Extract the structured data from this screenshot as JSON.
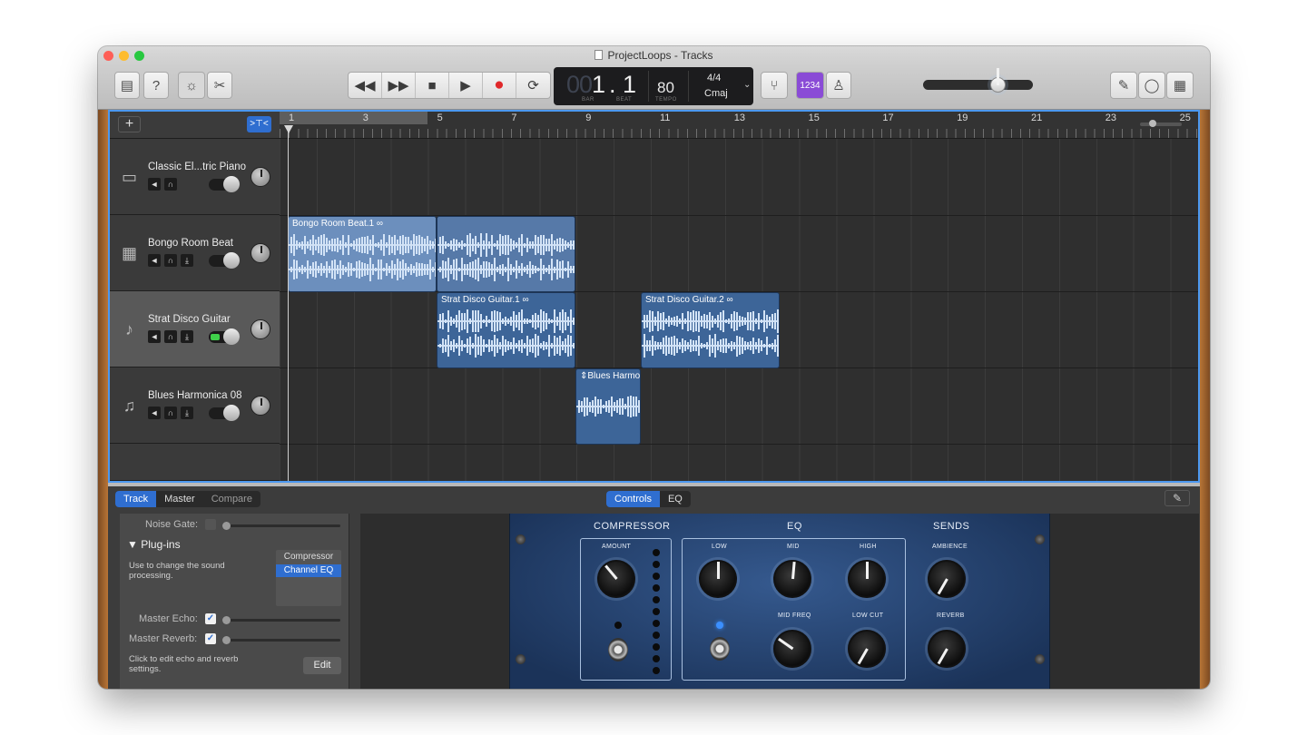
{
  "window": {
    "title": "ProjectLoops - Tracks"
  },
  "traffic_colors": {
    "close": "#fe5f57",
    "minimize": "#febc2e",
    "zoom": "#28c840"
  },
  "toolbar": {
    "lcd": {
      "bar_dim": "00",
      "bar": "1",
      "beat": ". 1",
      "bar_label": "BAR",
      "beat_label": "BEAT",
      "tempo": "80",
      "tempo_label": "TEMPO",
      "time_signature": "4/4",
      "key": "Cmaj"
    },
    "count_in": "1234",
    "master_volume": 0.69
  },
  "ruler": {
    "marks": [
      "1",
      "3",
      "5",
      "7",
      "9",
      "11",
      "13",
      "15",
      "17",
      "19",
      "21",
      "23",
      "25"
    ]
  },
  "tracks": [
    {
      "name": "Classic El...tric Piano",
      "icon": "piano-icon"
    },
    {
      "name": "Bongo Room Beat",
      "icon": "drum-machine-icon"
    },
    {
      "name": "Strat Disco Guitar",
      "icon": "guitar-icon"
    },
    {
      "name": "Blues Harmonica 08",
      "icon": "harmonica-icon"
    }
  ],
  "regions": [
    {
      "name": "Bongo Room Beat.1",
      "track": 2
    },
    {
      "name": "Strat Disco Guitar.1",
      "track": 3
    },
    {
      "name": "Strat Disco Guitar.2",
      "track": 3
    },
    {
      "name": "Blues Harmo",
      "track": 4
    }
  ],
  "bottom": {
    "tabs": [
      "Track",
      "Master",
      "Compare"
    ],
    "view_tabs": [
      "Controls",
      "EQ"
    ],
    "inspector": {
      "noise_gate": "Noise Gate:",
      "plugins_title": "Plug-ins",
      "plugins_desc": "Use to change the sound processing.",
      "plugins": [
        "Compressor",
        "Channel EQ"
      ],
      "master_echo": "Master Echo:",
      "master_reverb": "Master Reverb:",
      "echo_desc": "Click to edit echo and reverb settings.",
      "edit": "Edit"
    },
    "amp": {
      "sections": [
        "COMPRESSOR",
        "EQ",
        "SENDS"
      ],
      "knobs": {
        "amount": "AMOUNT",
        "low": "LOW",
        "mid": "MID",
        "high": "HIGH",
        "ambience": "AMBIENCE",
        "mid_freq": "MID FREQ",
        "low_cut": "LOW CUT",
        "reverb": "REVERB"
      }
    }
  }
}
